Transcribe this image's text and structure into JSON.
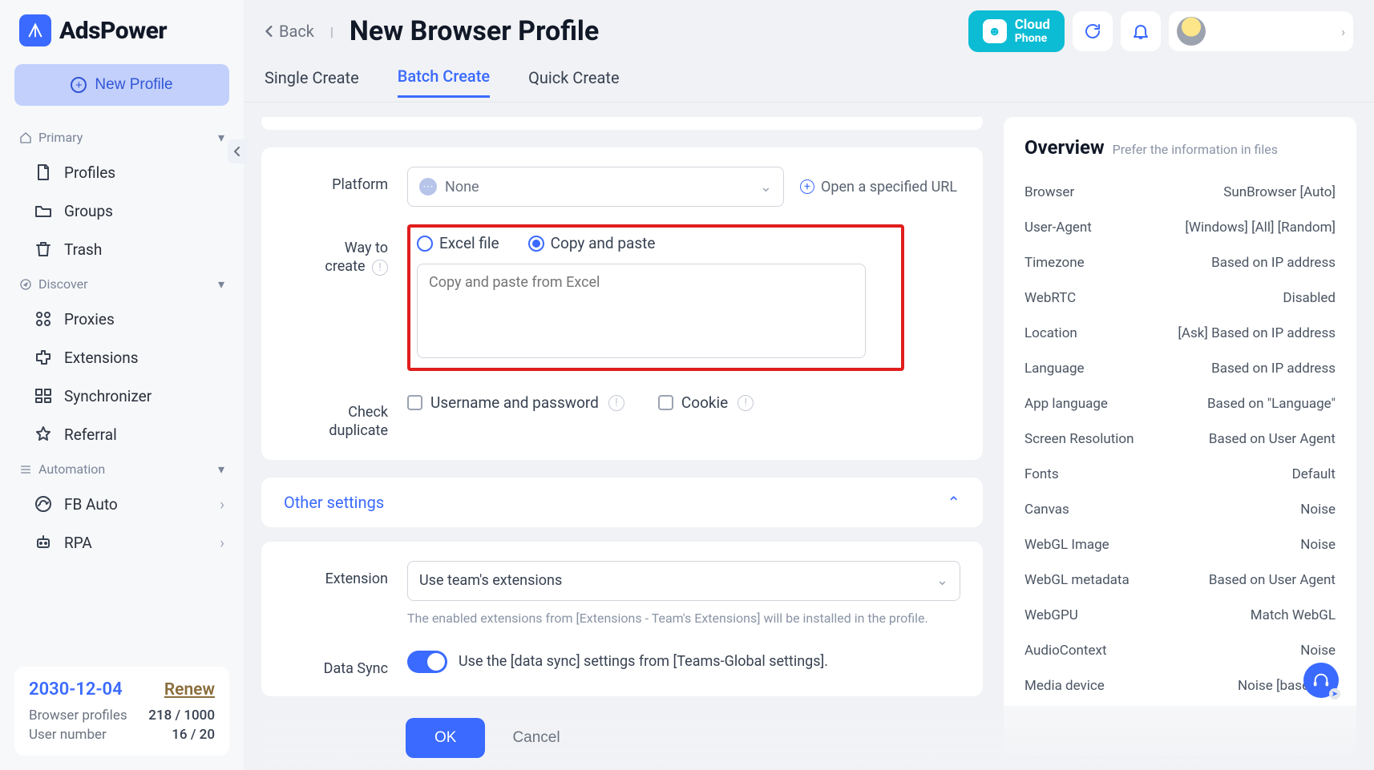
{
  "brand": "AdsPower",
  "sidebar": {
    "new_profile_label": "New Profile",
    "groups": [
      {
        "header": "Primary",
        "items": [
          {
            "label": "Profiles",
            "icon": "file-icon"
          },
          {
            "label": "Groups",
            "icon": "folder-icon"
          },
          {
            "label": "Trash",
            "icon": "trash-icon"
          }
        ]
      },
      {
        "header": "Discover",
        "items": [
          {
            "label": "Proxies",
            "icon": "proxies-icon"
          },
          {
            "label": "Extensions",
            "icon": "extensions-icon"
          },
          {
            "label": "Synchronizer",
            "icon": "synchronizer-icon"
          },
          {
            "label": "Referral",
            "icon": "star-icon"
          }
        ]
      },
      {
        "header": "Automation",
        "items": [
          {
            "label": "FB Auto",
            "icon": "fbauto-icon",
            "chevron": true
          },
          {
            "label": "RPA",
            "icon": "rpa-icon",
            "chevron": true
          }
        ]
      }
    ],
    "footer": {
      "date": "2030-12-04",
      "renew_label": "Renew",
      "row1_label": "Browser profiles",
      "row1_value": "218 / 1000",
      "row2_label": "User number",
      "row2_value": "16 / 20"
    }
  },
  "topbar": {
    "back_label": "Back",
    "title": "New Browser Profile",
    "cloud_line1": "Cloud",
    "cloud_line2": "Phone"
  },
  "tabs": [
    "Single Create",
    "Batch Create",
    "Quick Create"
  ],
  "active_tab_index": 1,
  "form": {
    "platform_label": "Platform",
    "platform_value": "None",
    "open_url_label": "Open a specified URL",
    "way_label_line1": "Way to",
    "way_label_line2": "create",
    "radio_excel": "Excel file",
    "radio_paste": "Copy and paste",
    "paste_placeholder": "Copy and paste from Excel",
    "check_dup_label_line1": "Check",
    "check_dup_label_line2": "duplicate",
    "chk_userpass": "Username and password",
    "chk_cookie": "Cookie",
    "other_settings_label": "Other settings",
    "extension_label": "Extension",
    "extension_value": "Use team's extensions",
    "extension_hint": "The enabled extensions from [Extensions - Team's Extensions] will be installed in the profile.",
    "datasync_label": "Data Sync",
    "datasync_text": "Use the [data sync] settings from [Teams-Global settings].",
    "ok_label": "OK",
    "cancel_label": "Cancel"
  },
  "overview": {
    "title": "Overview",
    "subtitle": "Prefer the information in files",
    "rows": [
      {
        "k": "Browser",
        "v": "SunBrowser [Auto]"
      },
      {
        "k": "User-Agent",
        "v": "[Windows] [All] [Random]"
      },
      {
        "k": "Timezone",
        "v": "Based on IP address"
      },
      {
        "k": "WebRTC",
        "v": "Disabled"
      },
      {
        "k": "Location",
        "v": "[Ask] Based on IP address"
      },
      {
        "k": "Language",
        "v": "Based on IP address"
      },
      {
        "k": "App language",
        "v": "Based on \"Language\""
      },
      {
        "k": "Screen Resolution",
        "v": "Based on User Agent"
      },
      {
        "k": "Fonts",
        "v": "Default"
      },
      {
        "k": "Canvas",
        "v": "Noise"
      },
      {
        "k": "WebGL Image",
        "v": "Noise"
      },
      {
        "k": "WebGL metadata",
        "v": "Based on User Agent"
      },
      {
        "k": "WebGPU",
        "v": "Match WebGL"
      },
      {
        "k": "AudioContext",
        "v": "Noise"
      },
      {
        "k": "Media device",
        "v": "Noise [based on"
      }
    ]
  }
}
